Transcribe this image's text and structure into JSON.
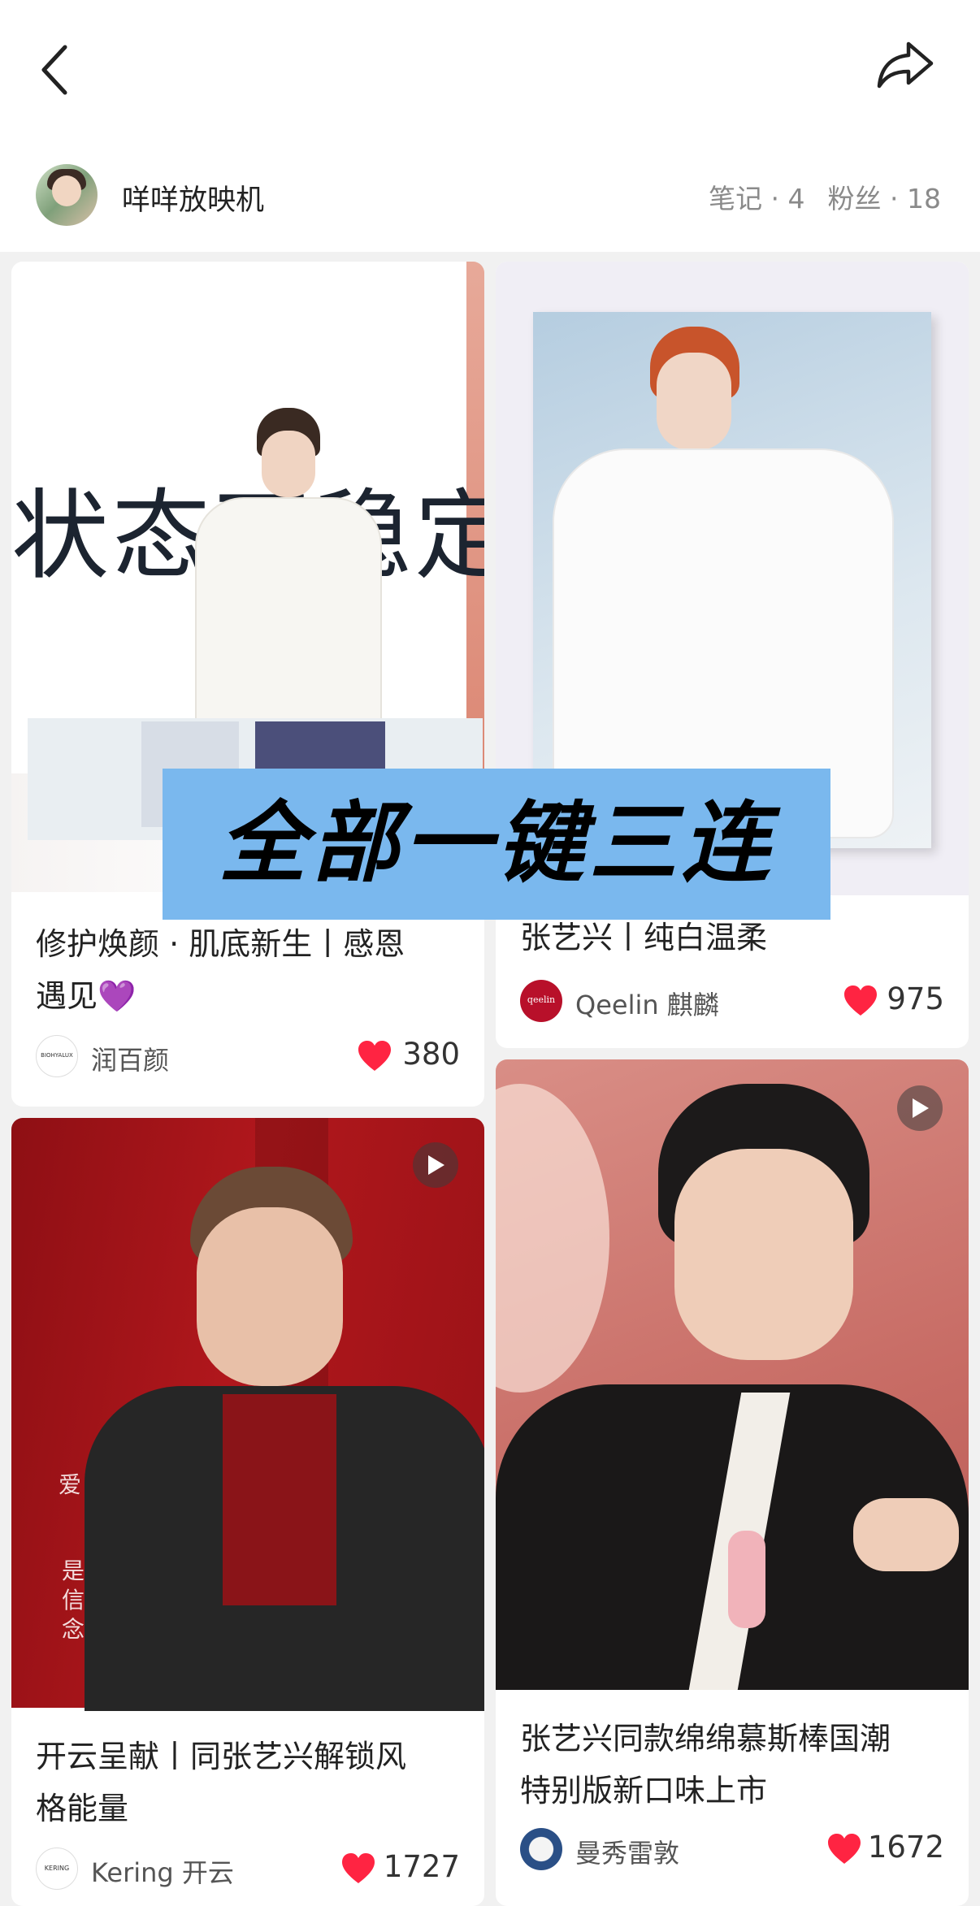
{
  "header": {
    "back_icon": "chevron-left-icon",
    "share_icon": "share-arrow-icon"
  },
  "profile": {
    "username": "咩咩放映机",
    "notes": "笔记 · 4",
    "fans": "粉丝 · 18"
  },
  "cards": [
    {
      "title_line1": "修护焕颜 · 肌底新生丨感恩",
      "title_line2": "遇见💜",
      "author": "润百颜",
      "author_logo_text": "BIOHYALUX",
      "likes": "380",
      "image_text": "状态不稳定"
    },
    {
      "title_line1": "张艺兴丨纯白温柔",
      "author": "Qeelin 麒麟",
      "author_logo_text": "qeelin",
      "likes": "975"
    },
    {
      "title_line1": "开云呈献丨同张艺兴解锁风",
      "title_line2": "格能量",
      "author": "Kering 开云",
      "author_logo_text": "KERING",
      "likes": "1727",
      "image_text_1": "爱",
      "image_text_2": "是信念"
    },
    {
      "title_line1": "张艺兴同款绵绵慕斯棒国潮",
      "title_line2": "特别版新口味上市",
      "author": "曼秀雷敦",
      "likes": "1672"
    }
  ],
  "overlay": {
    "banner_text": "全部一键三连",
    "banner_color": "#7ab8ee"
  },
  "colors": {
    "like": "#ff2442",
    "background": "#f1f1f1"
  }
}
